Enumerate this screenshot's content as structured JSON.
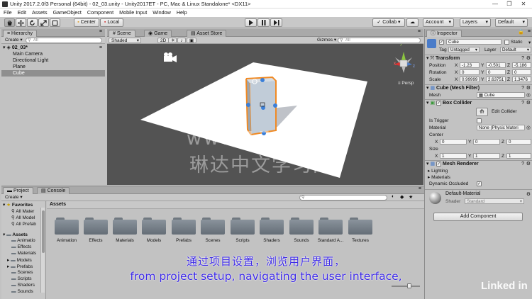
{
  "window": {
    "title": "Unity 2017.2.0f3 Personal (64bit) - 02_03.unity - Unity2017ET - PC, Mac & Linux Standalone* <DX11>",
    "minimize": "—",
    "maximize": "❐",
    "close": "✕"
  },
  "menu": [
    "File",
    "Edit",
    "Assets",
    "GameObject",
    "Component",
    "Mobile Input",
    "Window",
    "Help"
  ],
  "toolbar": {
    "tools": [
      "hand-icon",
      "move-icon",
      "rotate-icon",
      "scale-icon",
      "rect-icon"
    ],
    "pivot": "Center",
    "space": "Local",
    "collab": "Collab ▾",
    "account": "Account",
    "layers": "Layers",
    "layout": "Default"
  },
  "hierarchy": {
    "tab": "Hierarchy",
    "create": "Create ▾",
    "search_placeholder": "All",
    "scene": "02_03*",
    "items": [
      "Main Camera",
      "Directional Light",
      "Plane",
      "Cube"
    ],
    "selected": "Cube"
  },
  "scene": {
    "tabs": [
      "Scene",
      "Game",
      "Asset Store"
    ],
    "shading": "Shaded",
    "mode2d": "2D",
    "gizmos": "Gizmos ▾",
    "search_placeholder": "All",
    "persp": "Persp",
    "gizmo_axes": {
      "y": "y",
      "x": "x",
      "z": "z"
    },
    "colors": {
      "background": "#535353",
      "plane": "#ffffff",
      "cube": "#b5c0cc",
      "selection": "#f08a24"
    }
  },
  "inspector": {
    "tab": "Inspector",
    "name": "Cube",
    "static": "Static",
    "tag_label": "Tag",
    "tag": "Untagged",
    "layer_label": "Layer",
    "layer": "Default",
    "transform": {
      "title": "Transform",
      "rows": [
        {
          "label": "Position",
          "x": "-1.23",
          "y": "-0.501",
          "z": "-5.186"
        },
        {
          "label": "Rotation",
          "x": "0",
          "y": "0",
          "z": "0"
        },
        {
          "label": "Scale",
          "x": "0.99999",
          "y": "2.63751",
          "z": "1.3476"
        }
      ]
    },
    "mesh_filter": {
      "title": "Cube (Mesh Filter)",
      "label": "Mesh",
      "value": "Cube"
    },
    "box_collider": {
      "title": "Box Collider",
      "edit": "Edit Collider",
      "is_trigger": "Is Trigger",
      "material_label": "Material",
      "material": "None (Physic Materi",
      "center_label": "Center",
      "center": {
        "x": "0",
        "y": "0",
        "z": "0"
      },
      "size_label": "Size",
      "size": {
        "x": "1",
        "y": "1",
        "z": "1"
      }
    },
    "mesh_renderer": {
      "title": "Mesh Renderer",
      "lighting": "Lighting",
      "materials": "Materials",
      "dynamic_occluded": "Dynamic Occluded"
    },
    "material": {
      "name": "Default-Material",
      "shader_label": "Shader",
      "shader": "Standard"
    },
    "add_component": "Add Component"
  },
  "project": {
    "tabs": [
      "Project",
      "Console"
    ],
    "create": "Create ▾",
    "favorites": "Favorites",
    "fav_items": [
      "All Mater",
      "All Model",
      "All Prefab"
    ],
    "assets_root": "Assets",
    "tree_items": [
      "Animatio",
      "Effects",
      "Materials",
      "Models",
      "Prefabs",
      "Scenes",
      "Scripts",
      "Shaders",
      "Sounds"
    ],
    "breadcrumb": "Assets",
    "folders": [
      "Animation",
      "Effects",
      "Materials",
      "Models",
      "Prefabs",
      "Scenes",
      "Scripts",
      "Shaders",
      "Sounds",
      "Standard A...",
      "Textures"
    ]
  },
  "subtitles": {
    "chinese": "通过项目设置，浏览用户界面，",
    "english": "from project setup, navigating the user interface,"
  },
  "watermark": {
    "site": "www.1741.cn",
    "name": "琳达中文学习网"
  },
  "brand": "Linked in"
}
